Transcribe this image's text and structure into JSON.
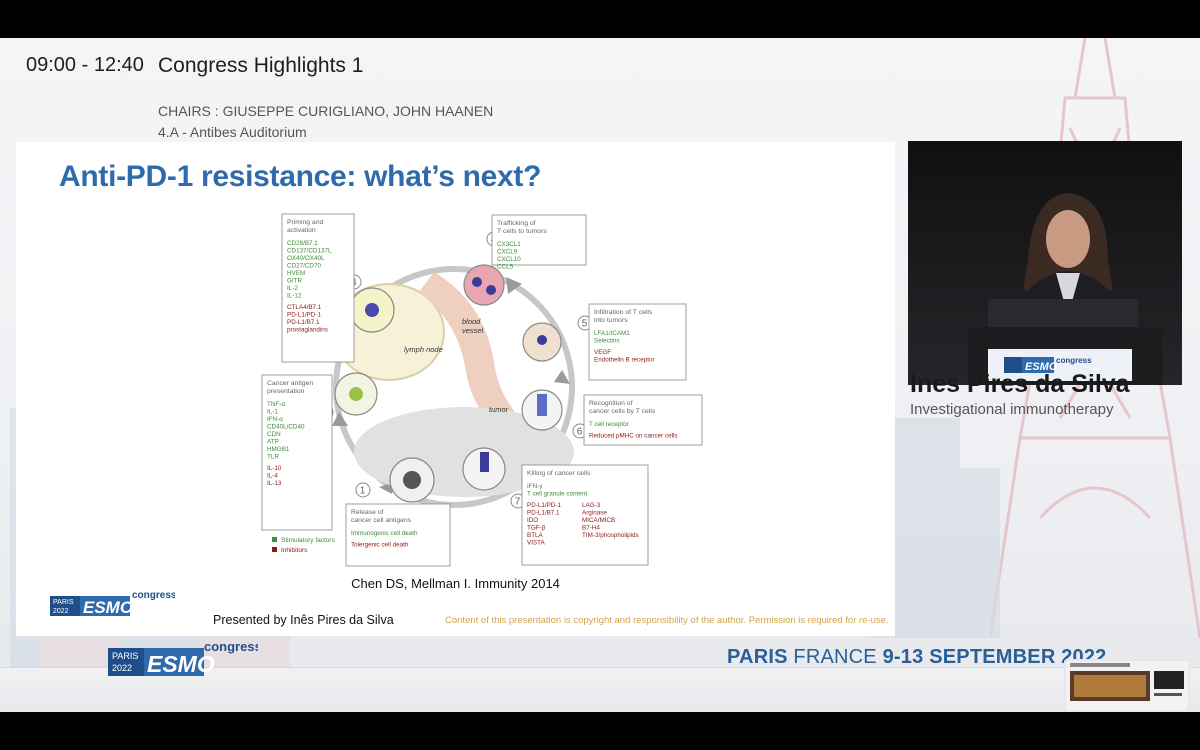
{
  "session": {
    "time": "09:00 - 12:40",
    "title": "Congress Highlights 1",
    "chairs": "CHAIRS : GIUSEPPE CURIGLIANO, JOHN HAANEN",
    "room": "4.A - Antibes Auditorium"
  },
  "slide": {
    "title": "Anti-PD-1 resistance: what’s next?",
    "citation": "Chen DS, Mellman I. Immunity 2014",
    "presented_by": "Presented by Inês Pires da Silva",
    "copyright": "Content of this presentation is copyright and responsibility of the author. Permission is required for re-use."
  },
  "figure": {
    "steps": [
      {
        "num": "1",
        "title": [
          "Release of",
          "cancer cell antigens"
        ],
        "green": [
          "Immunogenic cell death"
        ],
        "red": [
          "Tolergenic cell death"
        ]
      },
      {
        "num": "2",
        "title": [
          "Cancer antigen",
          "presentation"
        ],
        "green": [
          "TNF-α",
          "IL-1",
          "IFN-α",
          "CD40L/CD40",
          "CDN",
          "ATP",
          "HMGB1",
          "TLR"
        ],
        "red": [
          "IL-10",
          "IL-4",
          "IL-13"
        ]
      },
      {
        "num": "3",
        "title": [
          "Priming and",
          "activation"
        ],
        "green": [
          "CD28/B7.1",
          "CD137/CD137L",
          "OX40/OX40L",
          "CD27/CD70",
          "HVEM",
          "GITR",
          "IL-2",
          "IL-12"
        ],
        "red": [
          "CTLA4/B7.1",
          "PD-L1/PD-1",
          "PD-L1/B7.1",
          "prostaglandins"
        ]
      },
      {
        "num": "4",
        "title": [
          "Trafficking of",
          "T cells to tumors"
        ],
        "green": [
          "CX3CL1",
          "CXCL9",
          "CXCL10",
          "CCL5"
        ],
        "red": []
      },
      {
        "num": "5",
        "title": [
          "Infiltration of T cells",
          "into tumors"
        ],
        "green": [
          "LFA1/ICAM1",
          "Selectins"
        ],
        "red": [
          "VEGF",
          "Endothelin B receptor"
        ]
      },
      {
        "num": "6",
        "title": [
          "Recognition of",
          "cancer cells by T cells"
        ],
        "green": [
          "T cell receptor"
        ],
        "red": [
          "Reduced pMHC on cancer cells"
        ]
      },
      {
        "num": "7",
        "title": [
          "Killing of cancer cells"
        ],
        "green": [
          "IFN-γ",
          "T cell granule content"
        ],
        "red": [
          "PD-L1/PD-1",
          "PD-L1/B7.1",
          "IDO",
          "TGF-β",
          "BTLA",
          "VISTA"
        ],
        "red2": [
          "LAG-3",
          "Arginase",
          "MICA/MICB",
          "B7-H4",
          "TIM-3/phospholipids"
        ]
      }
    ],
    "labels": {
      "lymph_node": "lymph node",
      "blood_vessel": [
        "blood",
        "vessel"
      ],
      "tumor": "tumor"
    },
    "legend": {
      "stimulatory": "Stimulatory factors",
      "inhibitors": "Inhibitors"
    },
    "colors": {
      "green": "#3d8a3a",
      "red": "#8b1a1a",
      "box": "#888888"
    }
  },
  "speaker": {
    "name": "Ines Pires da Silva",
    "role": "Investigational immunotherapy"
  },
  "branding": {
    "city": "PARIS",
    "year": "2022",
    "brand": "ESMO",
    "suffix": "congress",
    "location_city": "PARIS",
    "location_country": "FRANCE",
    "dates": "9-13 SEPTEMBER 2022"
  },
  "colors": {
    "title_blue": "#2f6bac",
    "esmo_blue": "#2a5f97",
    "copyright_gold": "#d4a44a"
  }
}
